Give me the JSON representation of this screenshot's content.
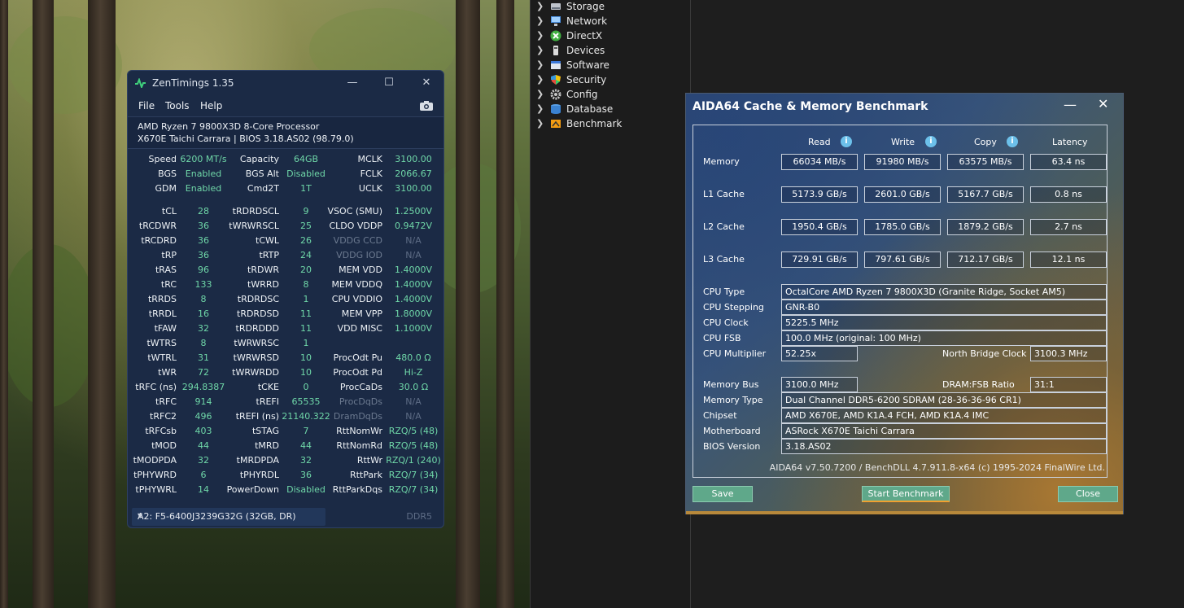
{
  "zentimings": {
    "title": "ZenTimings 1.35",
    "menu": [
      "File",
      "Tools",
      "Help"
    ],
    "cpu_line1": "AMD Ryzen 7 9800X3D 8-Core Processor",
    "cpu_line2": "X670E Taichi Carrara | BIOS 3.18.AS02 (98.79.0)",
    "top_rows": [
      [
        "Speed",
        "6200 MT/s",
        "Capacity",
        "64GB",
        "MCLK",
        "3100.00"
      ],
      [
        "BGS",
        "Enabled",
        "BGS Alt",
        "Disabled",
        "FCLK",
        "2066.67"
      ],
      [
        "GDM",
        "Enabled",
        "Cmd2T",
        "1T",
        "UCLK",
        "3100.00"
      ]
    ],
    "rows": [
      [
        "tCL",
        "28",
        "tRDRDSCL",
        "9",
        "VSOC (SMU)",
        "1.2500V"
      ],
      [
        "tRCDWR",
        "36",
        "tWRWRSCL",
        "25",
        "CLDO VDDP",
        "0.9472V"
      ],
      [
        "tRCDRD",
        "36",
        "tCWL",
        "26",
        "VDDG CCD",
        "N/A"
      ],
      [
        "tRP",
        "36",
        "tRTP",
        "24",
        "VDDG IOD",
        "N/A"
      ],
      [
        "tRAS",
        "96",
        "tRDWR",
        "20",
        "MEM VDD",
        "1.4000V"
      ],
      [
        "tRC",
        "133",
        "tWRRD",
        "8",
        "MEM VDDQ",
        "1.4000V"
      ],
      [
        "tRRDS",
        "8",
        "tRDRDSC",
        "1",
        "CPU VDDIO",
        "1.4000V"
      ],
      [
        "tRRDL",
        "16",
        "tRDRDSD",
        "11",
        "MEM VPP",
        "1.8000V"
      ],
      [
        "tFAW",
        "32",
        "tRDRDDD",
        "11",
        "VDD MISC",
        "1.1000V"
      ],
      [
        "tWTRS",
        "8",
        "tWRWRSC",
        "1",
        "",
        ""
      ],
      [
        "tWTRL",
        "31",
        "tWRWRSD",
        "10",
        "ProcOdt Pu",
        "480.0 Ω"
      ],
      [
        "tWR",
        "72",
        "tWRWRDD",
        "10",
        "ProcOdt Pd",
        "Hi-Z"
      ],
      [
        "tRFC (ns)",
        "294.8387",
        "tCKE",
        "0",
        "ProcCaDs",
        "30.0 Ω"
      ],
      [
        "tRFC",
        "914",
        "tREFI",
        "65535",
        "ProcDqDs",
        "N/A"
      ],
      [
        "tRFC2",
        "496",
        "tREFI (ns)",
        "21140.322",
        "DramDqDs",
        "N/A"
      ],
      [
        "tRFCsb",
        "403",
        "tSTAG",
        "7",
        "RttNomWr",
        "RZQ/5 (48)"
      ],
      [
        "tMOD",
        "44",
        "tMRD",
        "44",
        "RttNomRd",
        "RZQ/5 (48)"
      ],
      [
        "tMODPDA",
        "32",
        "tMRDPDA",
        "32",
        "RttWr",
        "RZQ/1 (240)"
      ],
      [
        "tPHYWRD",
        "6",
        "tPHYRDL",
        "36",
        "RttPark",
        "RZQ/7 (34)"
      ],
      [
        "tPHYWRL",
        "14",
        "PowerDown",
        "Disabled",
        "RttParkDqs",
        "RZQ/7 (34)"
      ]
    ],
    "dimm_selected": "A2: F5-6400J3239G32G (32GB, DR)",
    "ddr_label": "DDR5",
    "colors": {
      "value": "#6fd7a8",
      "bg": "#1b2a45",
      "dim": "#5e6d86"
    }
  },
  "tree": {
    "items": [
      {
        "label": "Storage",
        "icon": "storage-icon"
      },
      {
        "label": "Network",
        "icon": "network-icon"
      },
      {
        "label": "DirectX",
        "icon": "directx-icon"
      },
      {
        "label": "Devices",
        "icon": "devices-icon"
      },
      {
        "label": "Software",
        "icon": "software-icon"
      },
      {
        "label": "Security",
        "icon": "security-icon"
      },
      {
        "label": "Config",
        "icon": "config-icon"
      },
      {
        "label": "Database",
        "icon": "database-icon"
      },
      {
        "label": "Benchmark",
        "icon": "benchmark-icon"
      }
    ]
  },
  "aida": {
    "title": "AIDA64 Cache & Memory Benchmark",
    "headers": {
      "read": "Read",
      "write": "Write",
      "copy": "Copy",
      "latency": "Latency"
    },
    "bench": [
      {
        "label": "Memory",
        "read": "66034 MB/s",
        "write": "91980 MB/s",
        "copy": "63575 MB/s",
        "latency": "63.4 ns"
      },
      {
        "label": "L1 Cache",
        "read": "5173.9 GB/s",
        "write": "2601.0 GB/s",
        "copy": "5167.7 GB/s",
        "latency": "0.8 ns"
      },
      {
        "label": "L2 Cache",
        "read": "1950.4 GB/s",
        "write": "1785.0 GB/s",
        "copy": "1879.2 GB/s",
        "latency": "2.7 ns"
      },
      {
        "label": "L3 Cache",
        "read": "729.91 GB/s",
        "write": "797.61 GB/s",
        "copy": "712.17 GB/s",
        "latency": "12.1 ns"
      }
    ],
    "cpu_type_label": "CPU Type",
    "cpu_type": "OctalCore AMD Ryzen 7 9800X3D  (Granite Ridge, Socket AM5)",
    "cpu_stepping_label": "CPU Stepping",
    "cpu_stepping": "GNR-B0",
    "cpu_clock_label": "CPU Clock",
    "cpu_clock": "5225.5 MHz",
    "cpu_fsb_label": "CPU FSB",
    "cpu_fsb": "100.0 MHz  (original: 100 MHz)",
    "cpu_mult_label": "CPU Multiplier",
    "cpu_mult": "52.25x",
    "nb_clock_label": "North Bridge Clock",
    "nb_clock": "3100.3 MHz",
    "mem_bus_label": "Memory Bus",
    "mem_bus": "3100.0 MHz",
    "dram_fsb_label": "DRAM:FSB Ratio",
    "dram_fsb": "31:1",
    "mem_type_label": "Memory Type",
    "mem_type": "Dual Channel DDR5-6200 SDRAM  (28-36-36-96 CR1)",
    "chipset_label": "Chipset",
    "chipset": "AMD X670E, AMD K1A.4 FCH, AMD K1A.4 IMC",
    "mobo_label": "Motherboard",
    "mobo": "ASRock X670E Taichi Carrara",
    "bios_label": "BIOS Version",
    "bios": "3.18.AS02",
    "version": "AIDA64 v7.50.7200 / BenchDLL 4.7.911.8-x64  (c) 1995-2024 FinalWire Ltd.",
    "save_btn": "Save",
    "start_btn": "Start Benchmark",
    "close_btn": "Close"
  }
}
